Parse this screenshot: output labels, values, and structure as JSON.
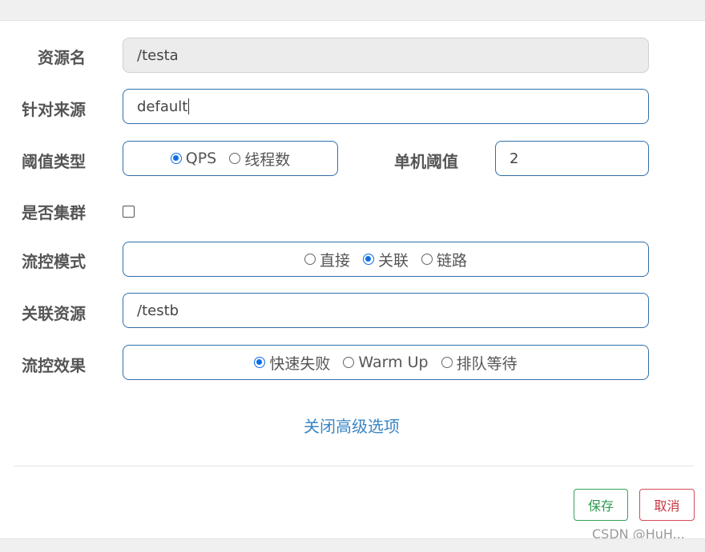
{
  "form": {
    "resource_name": {
      "label": "资源名",
      "value": "/testa"
    },
    "limit_app": {
      "label": "针对来源",
      "value": "default"
    },
    "threshold_type": {
      "label": "阈值类型",
      "options": [
        "QPS",
        "线程数"
      ],
      "selected": "QPS"
    },
    "single_threshold": {
      "label": "单机阈值",
      "value": "2"
    },
    "cluster_mode": {
      "label": "是否集群",
      "checked": false
    },
    "strategy": {
      "label": "流控模式",
      "options": [
        "直接",
        "关联",
        "链路"
      ],
      "selected": "关联"
    },
    "ref_resource": {
      "label": "关联资源",
      "value": "/testb"
    },
    "control_behavior": {
      "label": "流控效果",
      "options": [
        "快速失败",
        "Warm Up",
        "排队等待"
      ],
      "selected": "快速失败"
    },
    "advanced_toggle": "关闭高级选项"
  },
  "footer": {
    "save_label": "保存",
    "cancel_label": "取消"
  },
  "watermark": "CSDN @HuH...",
  "colors": {
    "accent": "#0b6ee6",
    "border": "#2f6fa8",
    "link": "#3a86c4",
    "save": "#2e9b4f",
    "cancel": "#c8343f"
  }
}
